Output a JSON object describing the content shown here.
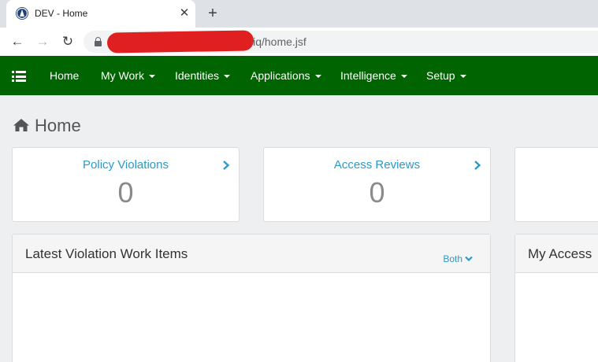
{
  "browser": {
    "tab": {
      "title": "DEV - Home",
      "close_glyph": "✕",
      "favicon": "sailpoint-logo-icon"
    },
    "new_tab_glyph": "+",
    "address_bar": {
      "url_visible": "iiq/home.jsf"
    },
    "nav": {
      "back_glyph": "←",
      "forward_glyph": "→",
      "reload_glyph": "↻"
    }
  },
  "appnav": {
    "color": "#006400",
    "items": [
      {
        "label": "Home"
      },
      {
        "label": "My Work"
      },
      {
        "label": "Identities"
      },
      {
        "label": "Applications"
      },
      {
        "label": "Intelligence"
      },
      {
        "label": "Setup"
      }
    ]
  },
  "page": {
    "title": "Home",
    "cards": [
      {
        "label": "Policy Violations",
        "count": "0"
      },
      {
        "label": "Access Reviews",
        "count": "0"
      }
    ],
    "panels": [
      {
        "title": "Latest Violation Work Items",
        "filter": "Both"
      },
      {
        "title": "My Access"
      }
    ],
    "accent_color": "#2b9ac9"
  }
}
